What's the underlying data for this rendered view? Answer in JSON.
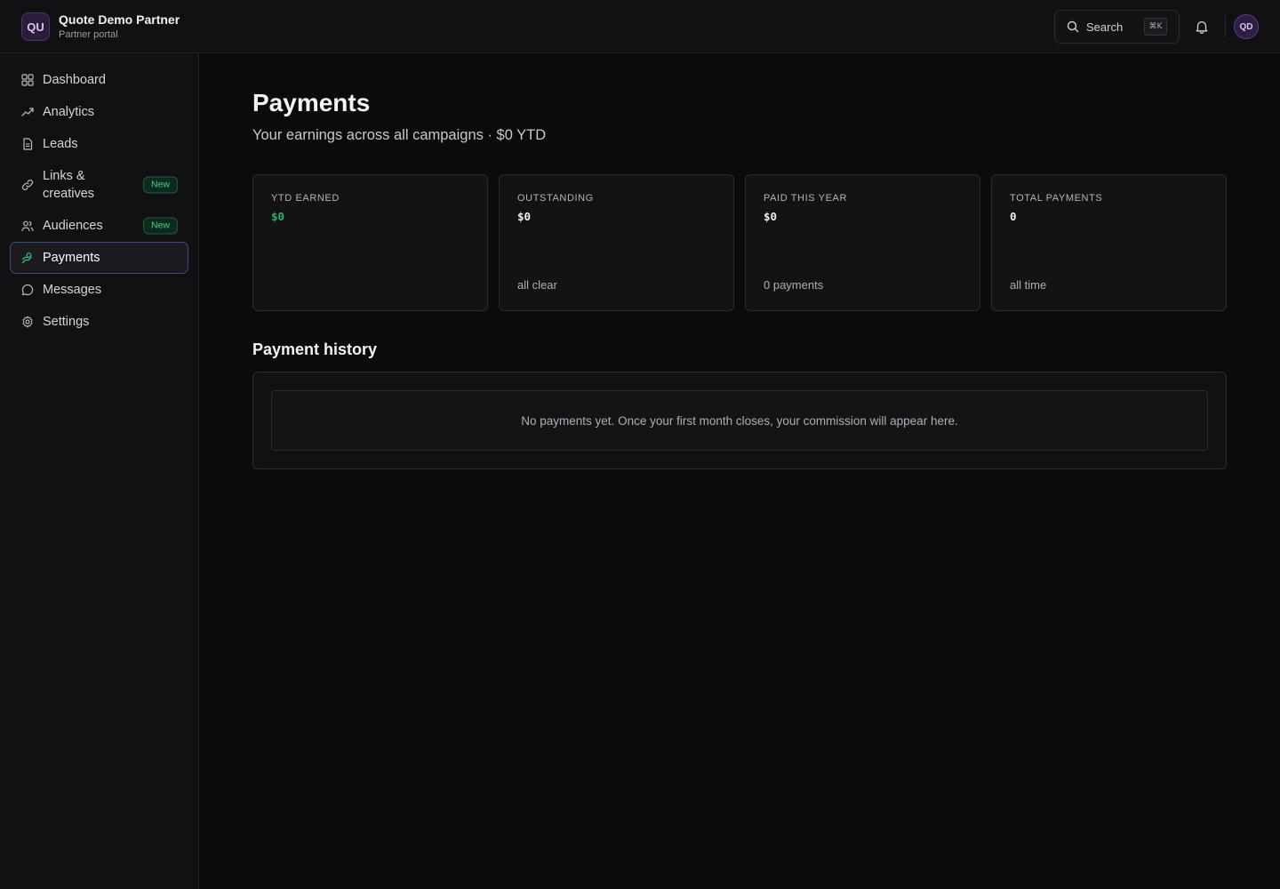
{
  "brand": {
    "logo_text": "QU",
    "name": "Quote Demo Partner",
    "subtitle": "Partner portal"
  },
  "header": {
    "search_label": "Search",
    "search_shortcut": "⌘K",
    "avatar_initials": "QD"
  },
  "sidebar": {
    "items": [
      {
        "label": "Dashboard",
        "icon": "grid-icon"
      },
      {
        "label": "Analytics",
        "icon": "trend-icon"
      },
      {
        "label": "Leads",
        "icon": "document-icon"
      },
      {
        "label": "Links & creatives",
        "icon": "link-icon",
        "badge": "New"
      },
      {
        "label": "Audiences",
        "icon": "users-icon",
        "badge": "New"
      },
      {
        "label": "Payments",
        "icon": "payments-icon",
        "active": true
      },
      {
        "label": "Messages",
        "icon": "chat-icon"
      },
      {
        "label": "Settings",
        "icon": "gear-icon"
      }
    ]
  },
  "page": {
    "title": "Payments",
    "subtitle": "Your earnings across all campaigns · $0 YTD"
  },
  "stats": [
    {
      "label": "YTD EARNED",
      "value": "$0",
      "foot": ""
    },
    {
      "label": "OUTSTANDING",
      "value": "$0",
      "foot": "all clear"
    },
    {
      "label": "PAID THIS YEAR",
      "value": "$0",
      "foot": "0 payments"
    },
    {
      "label": "TOTAL PAYMENTS",
      "value": "0",
      "foot": "all time"
    }
  ],
  "history": {
    "title": "Payment history",
    "empty_message": "No payments yet. Once your first month closes, your commission will appear here."
  },
  "colors": {
    "background": "#0b0b0c",
    "accent_green": "#22b573",
    "active_border": "#3a4a8a",
    "avatar_purple": "#5b3f86"
  }
}
